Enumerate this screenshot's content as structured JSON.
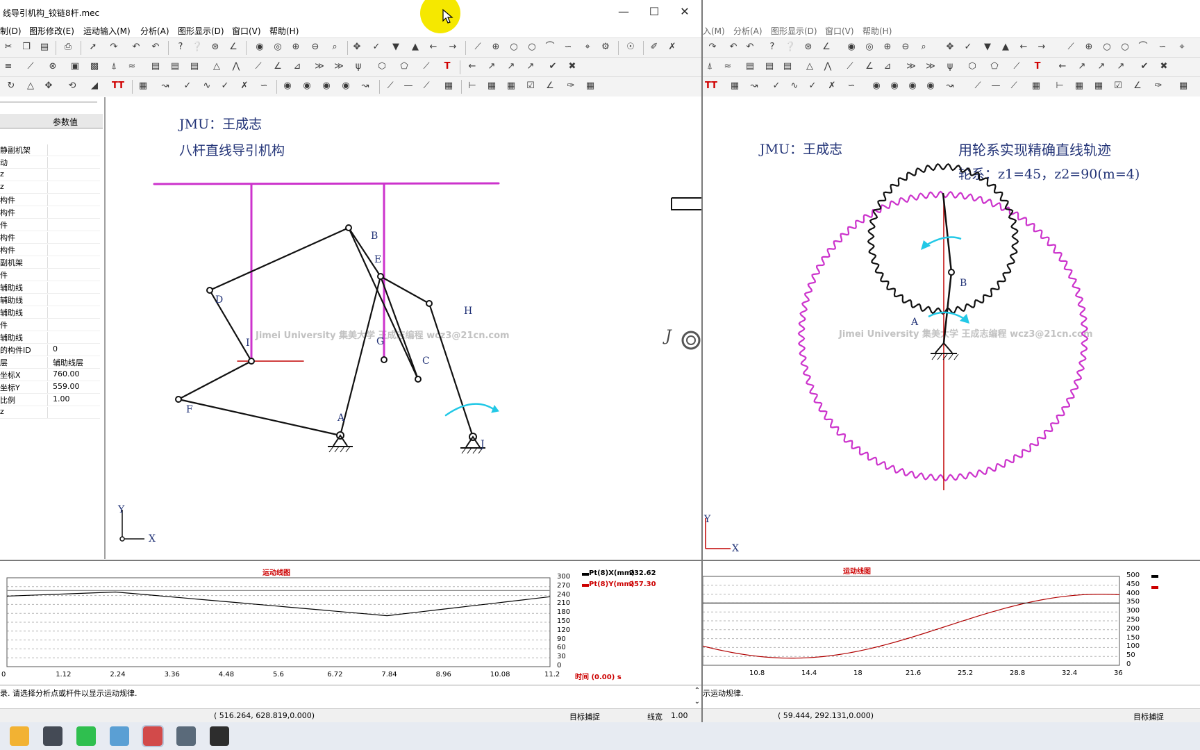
{
  "left_window": {
    "title": "线导引机构_铰链8杆.mec",
    "menus": [
      "制(D)",
      "图形修改(E)",
      "运动输入(M)",
      "分析(A)",
      "图形显示(D)",
      "窗口(V)",
      "帮助(H)"
    ],
    "props": {
      "header": "参数值",
      "rows": [
        {
          "name": "静副机架",
          "value": ""
        },
        {
          "name": "动",
          "value": ""
        },
        {
          "name": "z",
          "value": ""
        },
        {
          "name": "z",
          "value": ""
        },
        {
          "name": "构件",
          "value": ""
        },
        {
          "name": "构件",
          "value": ""
        },
        {
          "name": "件",
          "value": ""
        },
        {
          "name": "构件",
          "value": ""
        },
        {
          "name": "构件",
          "value": ""
        },
        {
          "name": "副机架",
          "value": ""
        },
        {
          "name": "件",
          "value": ""
        },
        {
          "name": "辅助线",
          "value": ""
        },
        {
          "name": "辅助线",
          "value": ""
        },
        {
          "name": "辅助线",
          "value": ""
        },
        {
          "name": "件",
          "value": ""
        },
        {
          "name": "辅助线",
          "value": ""
        },
        {
          "name": "的构件ID",
          "value": "0"
        },
        {
          "name": "层",
          "value": "辅助线层"
        },
        {
          "name": "坐标X",
          "value": "760.00"
        },
        {
          "name": "坐标Y",
          "value": "559.00"
        },
        {
          "name": "比例",
          "value": "1.00"
        },
        {
          "name": "z",
          "value": ""
        }
      ]
    },
    "canvas": {
      "author": "JMU：王成志",
      "subtitle": "八杆直线导引机构",
      "watermark": "Jimei University 集美大学 王成志编程  wcz3@21cn.com",
      "points": [
        "A",
        "B",
        "C",
        "D",
        "E",
        "F",
        "G",
        "H",
        "I",
        "J"
      ],
      "axis_x": "X",
      "axis_y": "Y",
      "edge_letter": "J"
    },
    "graph": {
      "title": "运动线图",
      "x_ticks": [
        "0",
        "1.12",
        "2.24",
        "3.36",
        "4.48",
        "5.6",
        "6.72",
        "7.84",
        "8.96",
        "10.08",
        "11.2"
      ],
      "y_ticks": [
        "300",
        "270",
        "240",
        "210",
        "180",
        "150",
        "120",
        "90",
        "60",
        "30",
        "0"
      ],
      "legend": [
        {
          "label": "Pt(8)X(mm)",
          "value": "232.62",
          "color": "#000000"
        },
        {
          "label": "Pt(8)Y(mm)",
          "value": "257.30",
          "color": "#cc0000"
        }
      ],
      "time_label": "时间 (0.00) s"
    },
    "message": "录. 请选择分析点或杆件以显示运动规律.",
    "status": {
      "coords": "(   516.264,    628.819,0.000)",
      "snap": "目标捕捉",
      "linewidth_label": "线宽",
      "linewidth_value": "1.00"
    }
  },
  "right_window": {
    "menus": [
      "入(M)",
      "分析(A)",
      "图形显示(D)",
      "窗口(V)",
      "帮助(H)"
    ],
    "canvas": {
      "author": "JMU：王成志",
      "title": "用轮系实现精确直线轨迹",
      "gear_info": "轮系：z1=45，z2=90(m=4)",
      "watermark": "Jimei University 集美大学 王成志编程  wcz3@21cn.com",
      "points": [
        "A",
        "B"
      ],
      "axis_x": "X",
      "axis_y": "Y"
    },
    "graph": {
      "title": "运动线图",
      "x_ticks": [
        "2",
        "10.8",
        "14.4",
        "18",
        "21.6",
        "25.2",
        "28.8",
        "32.4",
        "36"
      ],
      "y_ticks": [
        "500",
        "450",
        "400",
        "350",
        "300",
        "250",
        "200",
        "150",
        "100",
        "50",
        "0"
      ]
    },
    "message": "示运动规律.",
    "status": {
      "coords": "(   59.444,    292.131,0.000)",
      "snap": "目标捕捉"
    }
  },
  "colors": {
    "magenta": "#cc33cc",
    "red": "#c00000",
    "cyan": "#22c8e6",
    "label_blue": "#223377"
  },
  "taskbar_icons": [
    "file-explorer-icon",
    "store-icon",
    "wechat-icon",
    "notes-icon",
    "mechanism-app-icon",
    "calculator-icon",
    "media-player-icon"
  ]
}
